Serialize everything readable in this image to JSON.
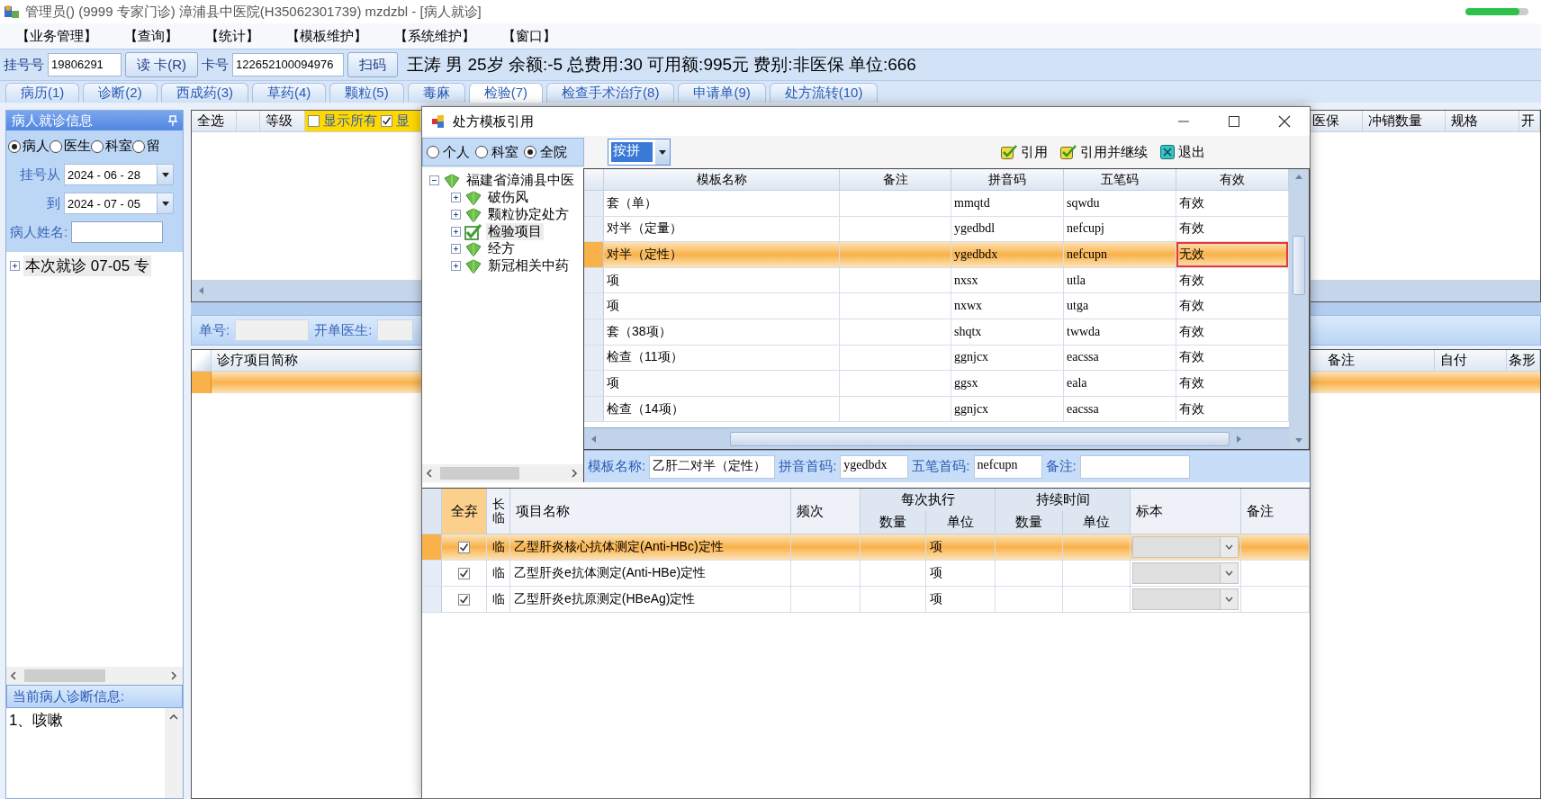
{
  "window": {
    "title": "管理员() (9999 专家门诊) 漳浦县中医院(H35062301739) mzdzbl - [病人就诊]",
    "progress": {
      "level": 0.85
    }
  },
  "menu": [
    "【业务管理】",
    "【查询】",
    "【统计】",
    "【模板维护】",
    "【系统维护】",
    "【窗口】"
  ],
  "patient_bar": {
    "reg_no_label": "挂号号",
    "reg_no": "19806291",
    "read_card_button": "读 卡(R)",
    "card_no_label": "卡号",
    "card_no": "122652100094976",
    "scan_button": "扫码",
    "info": "王涛 男 25岁 余额:-5 总费用:30 可用额:995元 费别:非医保 单位:666"
  },
  "tabs": [
    {
      "label": "病历(1)",
      "selected": false
    },
    {
      "label": "诊断(2)",
      "selected": false
    },
    {
      "label": "西成药(3)",
      "selected": false
    },
    {
      "label": "草药(4)",
      "selected": false
    },
    {
      "label": "颗粒(5)",
      "selected": false
    },
    {
      "label": "毒麻",
      "selected": false
    },
    {
      "label": "检验(7)",
      "selected": true
    },
    {
      "label": "检查手术治疗(8)",
      "selected": false
    },
    {
      "label": "申请单(9)",
      "selected": false
    },
    {
      "label": "处方流转(10)",
      "selected": false
    }
  ],
  "sidebar": {
    "title": "病人就诊信息",
    "filters": [
      {
        "label": "病人",
        "selected": true
      },
      {
        "label": "医生",
        "selected": false
      },
      {
        "label": "科室",
        "selected": false
      },
      {
        "label": "留",
        "selected": false
      }
    ],
    "date_from_label": "挂号从",
    "date_from": "2024 - 06 - 28",
    "date_to_label": "到",
    "date_to": "2024 - 07 - 05",
    "name_label": "病人姓名:",
    "visits": [
      {
        "label": "本次就诊  07-05  专",
        "expanded": false
      }
    ],
    "diagnosis_title": "当前病人诊断信息:",
    "diagnosis": "1、咳嗽"
  },
  "order_list": {
    "select_all": "全选",
    "level_column": "等级",
    "show_all": {
      "label": "显示所有",
      "checked": false
    },
    "show_other": {
      "label": "显",
      "checked": true
    },
    "right_columns": [
      "医保",
      "冲销数量",
      "规格",
      "开"
    ]
  },
  "order_detail": {
    "order_no_label": "单号:",
    "doctor_label": "开单医生:",
    "column": "诊疗项目简称",
    "right_columns": [
      "备注",
      "自付",
      "条形"
    ]
  },
  "dialog": {
    "title": "处方模板引用",
    "scopes": [
      {
        "label": "个人",
        "selected": false
      },
      {
        "label": "科室",
        "selected": false
      },
      {
        "label": "全院",
        "selected": true
      }
    ],
    "search_mode": "按拼",
    "actions": [
      {
        "label": "引用",
        "kind": "check"
      },
      {
        "label": "引用并继续",
        "kind": "check"
      },
      {
        "label": "退出",
        "kind": "exit"
      }
    ],
    "tree": {
      "label": "福建省漳浦县中医",
      "expanded": true,
      "children": [
        {
          "label": "破伤风",
          "expanded": false,
          "checked": false,
          "selected": false
        },
        {
          "label": "颗粒协定处方",
          "expanded": false,
          "checked": false,
          "selected": false
        },
        {
          "label": "检验项目",
          "expanded": false,
          "checked": true,
          "selected": true
        },
        {
          "label": "经方",
          "expanded": false,
          "checked": false,
          "selected": false
        },
        {
          "label": "新冠相关中药",
          "expanded": false,
          "checked": false,
          "selected": false
        }
      ]
    },
    "template_columns": [
      "模板名称",
      "备注",
      "拼音码",
      "五笔码",
      "有效"
    ],
    "templates": [
      {
        "name": "套（单）",
        "pinyin": "mmqtd",
        "wubi": "sqwdu",
        "valid": "有效",
        "selected": false,
        "highlighted": false
      },
      {
        "name": "对半（定量）",
        "pinyin": "ygedbdl",
        "wubi": "nefcupj",
        "valid": "有效",
        "selected": false,
        "highlighted": false
      },
      {
        "name": "对半（定性）",
        "pinyin": "ygedbdx",
        "wubi": "nefcupn",
        "valid": "无效",
        "selected": true,
        "highlighted": true
      },
      {
        "name": "项",
        "pinyin": "nxsx",
        "wubi": "utla",
        "valid": "有效",
        "selected": false,
        "highlighted": false
      },
      {
        "name": "项",
        "pinyin": "nxwx",
        "wubi": "utga",
        "valid": "有效",
        "selected": false,
        "highlighted": false
      },
      {
        "name": "套（38项）",
        "pinyin": "shqtx",
        "wubi": "twwda",
        "valid": "有效",
        "selected": false,
        "highlighted": false
      },
      {
        "name": "检查（11项）",
        "pinyin": "ggnjcx",
        "wubi": "eacssa",
        "valid": "有效",
        "selected": false,
        "highlighted": false
      },
      {
        "name": "项",
        "pinyin": "ggsx",
        "wubi": "eala",
        "valid": "有效",
        "selected": false,
        "highlighted": false
      },
      {
        "name": "检查（14项）",
        "pinyin": "ggnjcx",
        "wubi": "eacssa",
        "valid": "有效",
        "selected": false,
        "highlighted": false
      }
    ],
    "form": {
      "name_label": "模板名称:",
      "name": "乙肝二对半（定性）",
      "pinyin_label": "拼音首码:",
      "pinyin": "ygedbdx",
      "wubi_label": "五笔首码:",
      "wubi": "nefcupn",
      "note_label": "备注:"
    },
    "items_header": {
      "discard": "全弃",
      "term": "长临",
      "name": "项目名称",
      "frequency": "频次",
      "per_dose": "每次执行",
      "duration": "持续时间",
      "per_dose_quantity": "数量",
      "per_dose_unit": "单位",
      "duration_quantity": "数量",
      "duration_unit": "单位",
      "specimen": "标本",
      "note": "备注"
    },
    "items": [
      {
        "discard": true,
        "term": "临",
        "name": "乙型肝炎核心抗体测定(Anti-HBc)定性",
        "unit": "项",
        "selected": true
      },
      {
        "discard": true,
        "term": "临",
        "name": "乙型肝炎e抗体测定(Anti-HBe)定性",
        "unit": "项",
        "selected": false
      },
      {
        "discard": true,
        "term": "临",
        "name": "乙型肝炎e抗原测定(HBeAg)定性",
        "unit": "项",
        "selected": false
      }
    ]
  }
}
